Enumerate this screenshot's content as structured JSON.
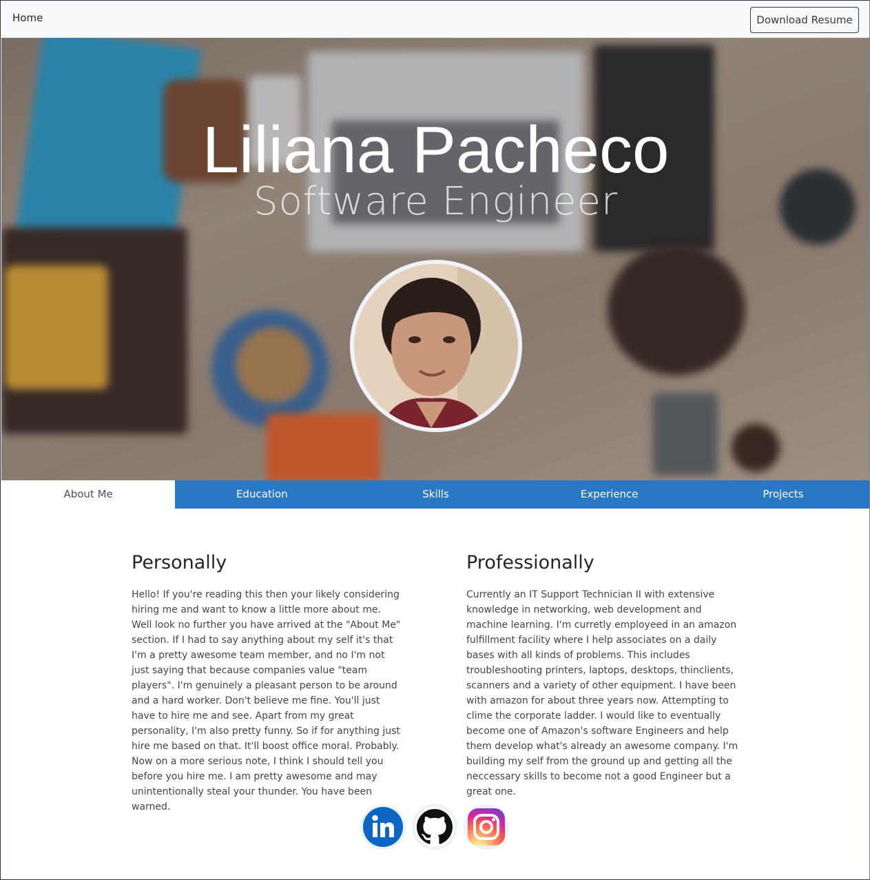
{
  "nav": {
    "home_label": "Home",
    "download_label": "Download Resume"
  },
  "hero": {
    "name": "Liliana Pacheco",
    "title": "Software Engineer"
  },
  "tabs": [
    {
      "label": "About Me",
      "active": true
    },
    {
      "label": "Education",
      "active": false
    },
    {
      "label": "Skills",
      "active": false
    },
    {
      "label": "Experience",
      "active": false
    },
    {
      "label": "Projects",
      "active": false
    }
  ],
  "about": {
    "personal_heading": "Personally",
    "personal_text": "Hello! If you're reading this then your likely considering hiring me and want to know a little more about me. Well look no further you have arrived at the \"About Me\" section. If I had to say anything about my self it's that I'm a pretty awesome team member, and no I'm not just saying that because companies value \"team players\". I'm genuinely a pleasant person to be around and a hard worker. Don't believe me fine. You'll just have to hire me and see. Apart from my great personality, I'm also pretty funny. So if for anything just hire me based on that. It'll boost office moral. Probably. Now on a more serious note, I think I should tell you before you hire me. I am pretty awesome and may unintentionally steal your thunder. You have been warned.",
    "professional_heading": "Professionally",
    "professional_text": "Currently an IT Support Technician II with extensive knowledge in networking, web development and machine learning. I'm curretly employeed in an amazon fulfillment facility where I help associates on a daily bases with all kinds of problems. This includes troubleshooting printers, laptops, desktops, thinclients, scanners and a variety of other equipment. I have been with amazon for about three years now. Attempting to clime the corporate ladder. I would like to eventually become one of Amazon's software Engineers and help them develop what's already an awesome company. I'm building my self from the ground up and getting all the neccessary skills to become not a good Engineer but a great one."
  },
  "socials": [
    {
      "icon": "linkedin-icon",
      "color": "#0a66c2"
    },
    {
      "icon": "github-icon",
      "color": "#000000"
    },
    {
      "icon": "instagram-icon",
      "color": "#d6249f"
    }
  ],
  "colors": {
    "tab_bar": "#2878c3",
    "avatar_border": "#eef3fb"
  }
}
